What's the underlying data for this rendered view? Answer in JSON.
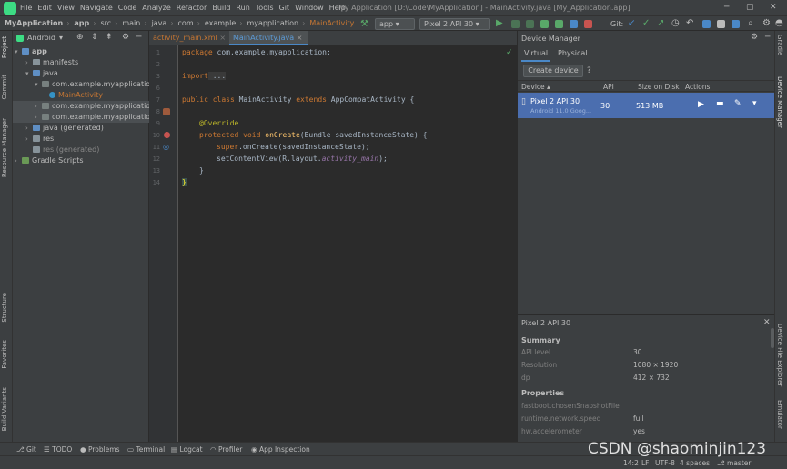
{
  "menu": {
    "items": [
      "File",
      "Edit",
      "View",
      "Navigate",
      "Code",
      "Analyze",
      "Refactor",
      "Build",
      "Run",
      "Tools",
      "Git",
      "Window",
      "Help"
    ],
    "window_title": "My Application [D:\\Code\\MyApplication] - MainActivity.java [My_Application.app]"
  },
  "breadcrumb": [
    "MyApplication",
    "app",
    "src",
    "main",
    "java",
    "com",
    "example",
    "myapplication",
    "MainActivity"
  ],
  "toolbar": {
    "run_config": "app",
    "device": "Pixel 2 API 30",
    "git_label": "Git:"
  },
  "project": {
    "view": "Android",
    "tree": [
      {
        "label": "app"
      },
      {
        "label": "manifests"
      },
      {
        "label": "java"
      },
      {
        "label": "com.example.myapplication"
      },
      {
        "label": "MainActivity"
      },
      {
        "label": "com.example.myapplication (androidTest)"
      },
      {
        "label": "com.example.myapplication (test)"
      },
      {
        "label": "java (generated)"
      },
      {
        "label": "res"
      },
      {
        "label": "res (generated)"
      },
      {
        "label": "Gradle Scripts"
      }
    ]
  },
  "left_tabs": [
    "Project",
    "Commit",
    "Resource Manager",
    "Structure",
    "Favorites",
    "Build Variants"
  ],
  "right_tabs": [
    "Gradle",
    "Device Manager",
    "Device File Explorer",
    "Emulator"
  ],
  "editor": {
    "tabs": [
      "activity_main.xml",
      "MainActivity.java"
    ],
    "line_numbers": [
      "1",
      "2",
      "3",
      "6",
      "7",
      "8",
      "9",
      "10",
      "11",
      "12",
      "13",
      "14"
    ],
    "lines": {
      "l1_kw": "package",
      "l1": " com.example.myapplication;",
      "l3_kw": "import",
      "l3": " ...",
      "l7_kw1": "public class",
      "l7_name": " MainActivity ",
      "l7_kw2": "extends",
      "l7_rest": " AppCompatActivity {",
      "l9": "@Override",
      "l10_kw": "protected void",
      "l10_fn": " onCreate",
      "l10_rest": "(Bundle savedInstanceState) {",
      "l11_kw": "super",
      "l11_rest": ".onCreate(savedInstanceState);",
      "l12_a": "setContentView(R.layout.",
      "l12_it": "activity_main",
      "l12_b": ");",
      "l13": "}",
      "l14": "}"
    }
  },
  "device_manager": {
    "title": "Device Manager",
    "tabs": [
      "Virtual",
      "Physical"
    ],
    "create_button": "Create device",
    "help": "?",
    "columns": [
      "Device",
      "API",
      "Size on Disk",
      "Actions"
    ],
    "device": {
      "name": "Pixel 2 API 30",
      "sub": "Android 11.0 Goog...",
      "api": "30",
      "size": "513 MB"
    },
    "details_title": "Pixel 2 API 30",
    "summary_heading": "Summary",
    "summary": [
      {
        "k": "API level",
        "v": "30"
      },
      {
        "k": "Resolution",
        "v": "1080 × 1920"
      },
      {
        "k": "dp",
        "v": "412 × 732"
      }
    ],
    "properties_heading": "Properties",
    "properties": [
      {
        "k": "fastboot.chosenSnapshotFile",
        "v": ""
      },
      {
        "k": "runtime.network.speed",
        "v": "full"
      },
      {
        "k": "hw.accelerometer",
        "v": "yes"
      }
    ]
  },
  "bottom_tools": [
    "Git",
    "TODO",
    "Problems",
    "Terminal",
    "Logcat",
    "Profiler",
    "App Inspection"
  ],
  "status": {
    "position": "14:2",
    "line_sep": "LF",
    "encoding": "UTF-8",
    "indent": "4 spaces",
    "branch": "master"
  },
  "watermark": "CSDN @shaominjin123",
  "colors": {
    "accent": "#4a88c7",
    "selection": "#4b6eaf",
    "run_green": "#59a869",
    "keyword": "#cc7832"
  }
}
